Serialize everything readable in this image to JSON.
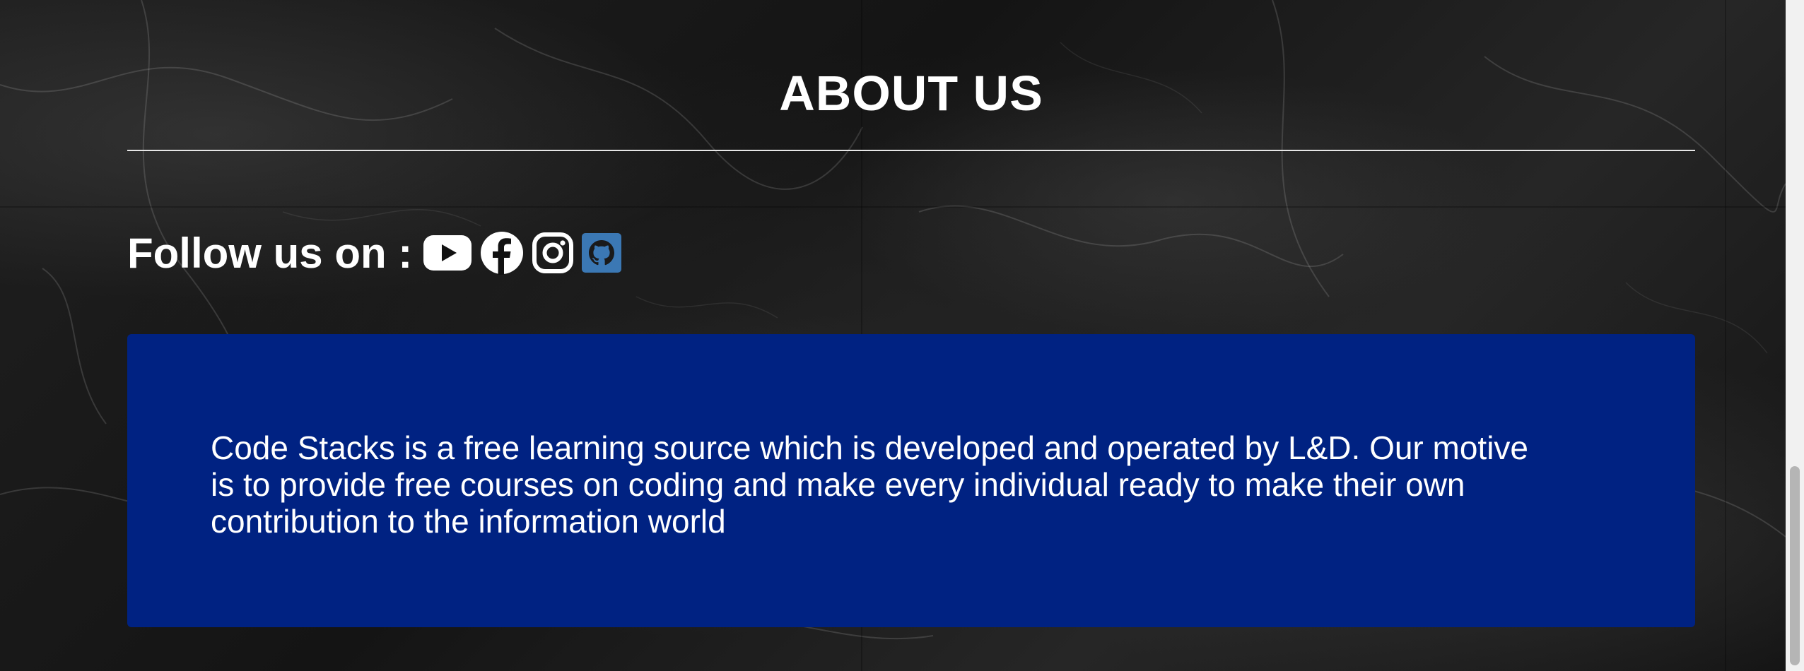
{
  "section": {
    "title": "ABOUT US"
  },
  "follow": {
    "label": "Follow us on :",
    "icons": [
      {
        "name": "youtube-icon"
      },
      {
        "name": "facebook-icon"
      },
      {
        "name": "instagram-icon"
      },
      {
        "name": "github-icon",
        "color": "#3b78b4"
      }
    ]
  },
  "about": {
    "text": "Code Stacks is a free learning source which is developed and operated by L&D. Our motive is to provide free courses on coding and make every individual ready to make their own contribution to the information world",
    "background": "#002282"
  }
}
